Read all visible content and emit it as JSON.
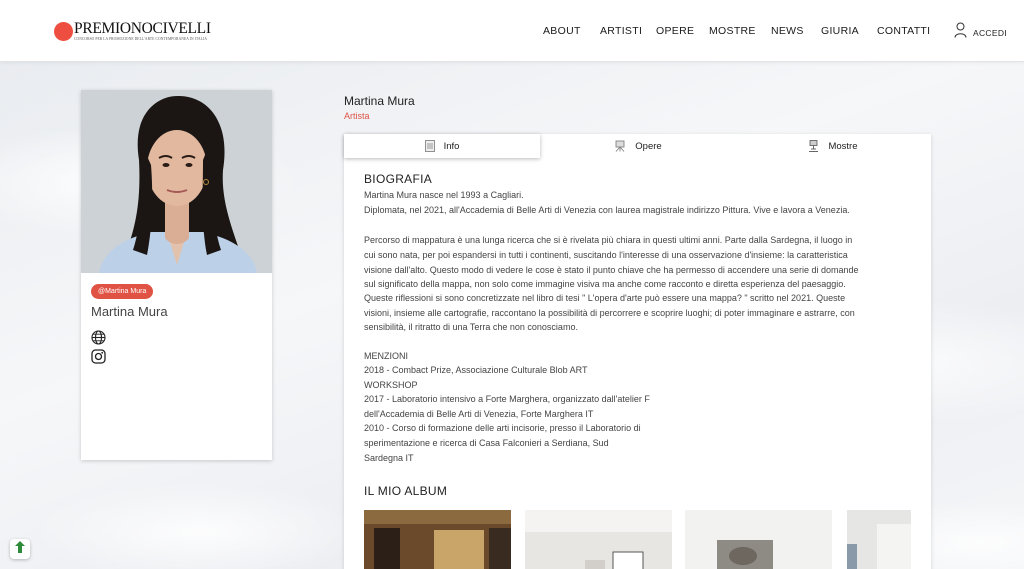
{
  "logo": {
    "name": "PREMIONOCIVELLI",
    "tagline": "CONCORSO PER LA PROMOZIONE DELL'ARTE CONTEMPORANEA IN ITALIA"
  },
  "nav": {
    "items": [
      "ABOUT",
      "ARTISTI",
      "OPERE",
      "MOSTRE",
      "NEWS",
      "GIURIA",
      "CONTATTI"
    ],
    "login": "ACCEDI"
  },
  "profile": {
    "handle": "@Martina Mura",
    "name": "Martina Mura",
    "social": [
      "globe-icon",
      "instagram-icon"
    ]
  },
  "artist": {
    "name": "Martina Mura",
    "role": "Artista"
  },
  "tabs": [
    "Info",
    "Opere",
    "Mostre"
  ],
  "bio": {
    "title": "BIOGRAFIA",
    "lines": [
      "Martina Mura nasce nel 1993 a Cagliari.",
      "Diplomata, nel 2021, all'Accademia di Belle Arti di Venezia con laurea magistrale indirizzo Pittura. Vive e lavora a Venezia.",
      "",
      "Percorso di mappatura è una lunga ricerca che si è rivelata più chiara in questi ultimi anni. Parte dalla Sardegna, il luogo in",
      "cui sono nata, per poi espandersi in tutti i continenti, suscitando l'interesse di una osservazione d'insieme: la caratteristica",
      "visione dall'alto. Questo modo di vedere le cose è stato il punto chiave che ha permesso di accendere una serie di domande",
      "sul significato della mappa, non solo come immagine visiva ma anche come racconto e diretta esperienza del paesaggio.",
      "Queste riflessioni si sono concretizzate nel libro di tesi \" L'opera d'arte può essere una mappa? \" scritto nel 2021. Queste",
      "visioni, insieme alle cartografie, raccontano la possibilità di percorrere e scoprire luoghi; di poter immaginare e astrarre, con",
      "sensibilità, il ritratto di una Terra che non conosciamo.",
      "",
      "MENZIONI",
      "2018 - Combact Prize, Associazione Culturale Blob ART",
      "WORKSHOP",
      "2017 - Laboratorio intensivo a Forte Marghera, organizzato dall'atelier F",
      "dell'Accademia di Belle Arti di Venezia, Forte Marghera IT",
      "2010 - Corso di formazione delle arti incisorie, presso il Laboratorio di",
      "sperimentazione e ricerca di Casa Falconieri a Serdiana, Sud",
      "Sardegna IT"
    ]
  },
  "album": {
    "title": "IL MIO ALBUM"
  },
  "colors": {
    "accent": "#e05244",
    "logo_dot": "#ee4e3f"
  }
}
